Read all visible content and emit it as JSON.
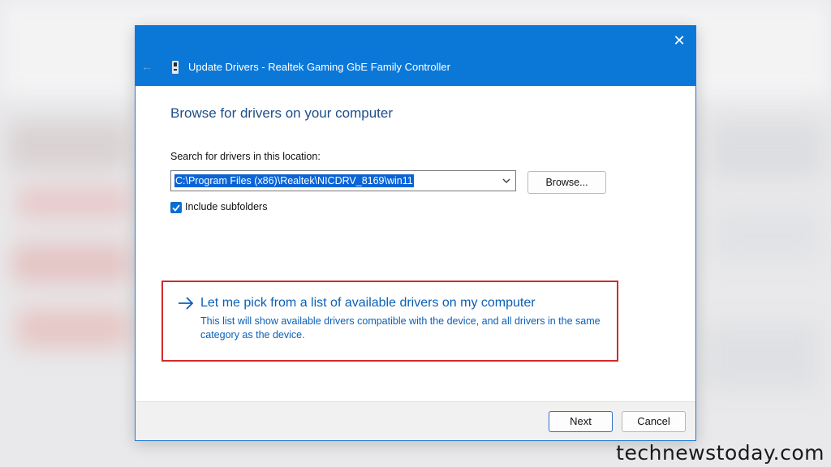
{
  "window": {
    "title": "Update Drivers - Realtek Gaming GbE Family Controller",
    "close_glyph": "✕",
    "back_glyph": "←"
  },
  "content": {
    "heading": "Browse for drivers on your computer",
    "search_label": "Search for drivers in this location:",
    "path_value": "C:\\Program Files (x86)\\Realtek\\NICDRV_8169\\win11",
    "browse_label": "Browse...",
    "include_subfolders_label": "Include subfolders",
    "include_subfolders_checked": true
  },
  "pick_option": {
    "title": "Let me pick from a list of available drivers on my computer",
    "description": "This list will show available drivers compatible with the device, and all drivers in the same category as the device."
  },
  "footer": {
    "next_label": "Next",
    "cancel_label": "Cancel"
  },
  "watermark": "technewstoday.com",
  "colors": {
    "titlebar": "#0b78d8",
    "link_blue": "#0b5fb8",
    "highlight_red": "#d22a2a",
    "selection_blue": "#0a64d6"
  },
  "icons": [
    "close-icon",
    "back-arrow-icon",
    "device-icon",
    "chevron-down-icon",
    "checkmark-icon",
    "right-arrow-icon"
  ]
}
